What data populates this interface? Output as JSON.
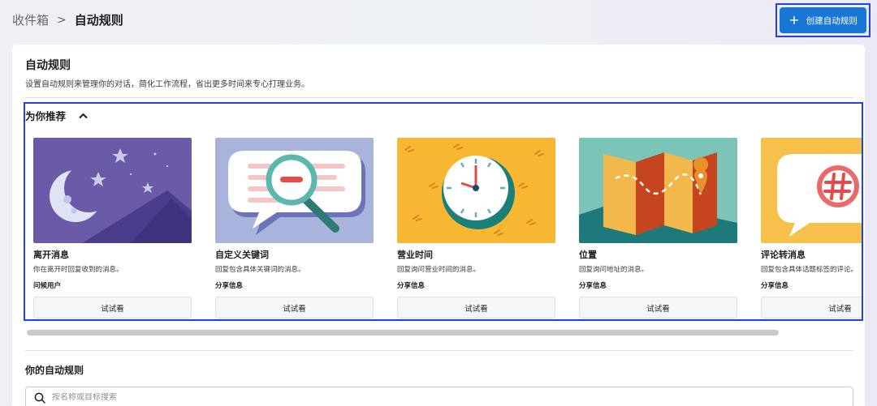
{
  "breadcrumb": {
    "parent": "收件箱",
    "separator": ">",
    "current": "自动规则"
  },
  "header": {
    "create_label": "创建自动规则"
  },
  "section": {
    "title": "自动规则",
    "description": "设置自动规则来管理你的对话，简化工作流程，省出更多时间来专心打理业务。"
  },
  "recommended": {
    "title": "为你推荐",
    "tiles": [
      {
        "title": "离开消息",
        "desc": "你在离开时回复收到的消息。",
        "tag": "问候用户",
        "button": "试试看",
        "icon": "moon-icon"
      },
      {
        "title": "自定义关键词",
        "desc": "回复包含具体关键词的消息。",
        "tag": "分享信息",
        "button": "试试看",
        "icon": "magnifier-icon"
      },
      {
        "title": "营业时间",
        "desc": "回复询问营业时间的消息。",
        "tag": "分享信息",
        "button": "试试看",
        "icon": "clock-icon"
      },
      {
        "title": "位置",
        "desc": "回复询问地址的消息。",
        "tag": "分享信息",
        "button": "试试看",
        "icon": "map-icon"
      },
      {
        "title": "评论转消息",
        "desc": "回复包含具体话题标签的评论。",
        "tag": "分享信息",
        "button": "试试看",
        "icon": "hashtag-icon"
      }
    ]
  },
  "yours": {
    "title": "你的自动规则",
    "search_placeholder": "按名称或目标搜索"
  },
  "colors": {
    "primary": "#1877d6",
    "highlight": "#1f43e0"
  }
}
